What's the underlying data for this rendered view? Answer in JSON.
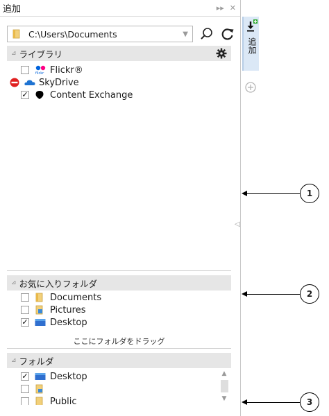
{
  "panel": {
    "title": "追加",
    "pin_glyph": "▸▸",
    "close_glyph": "✕"
  },
  "path_bar": {
    "path": "C:\\Users\\Documents",
    "dropdown_glyph": "▼",
    "icons": [
      "folder-icon",
      "search-icon",
      "refresh-icon"
    ]
  },
  "library": {
    "header": "ライブラリ",
    "collapse_glyph": "⊿",
    "items": [
      {
        "label": "Flickr®",
        "checked": false,
        "icon": "flickr-icon"
      },
      {
        "label": "SkyDrive",
        "checked": false,
        "icon": "skydrive-icon"
      },
      {
        "label": "Content Exchange",
        "checked": true,
        "icon": "content-exchange-icon"
      }
    ]
  },
  "favorites": {
    "header": "お気に入りフォルダ",
    "collapse_glyph": "⊿",
    "items": [
      {
        "label": "Documents",
        "checked": false,
        "icon": "documents-folder-icon"
      },
      {
        "label": "Pictures",
        "checked": false,
        "icon": "pictures-folder-icon"
      },
      {
        "label": "Desktop",
        "checked": true,
        "icon": "desktop-folder-icon"
      }
    ],
    "drop_hint": "ここにフォルダをドラッグ"
  },
  "folders": {
    "header": "フォルダ",
    "collapse_glyph": "⊿",
    "items": [
      {
        "label": "Desktop",
        "checked": true,
        "icon": "desktop-folder-icon"
      },
      {
        "label": "",
        "checked": false,
        "icon": "user-folder-icon"
      },
      {
        "label": "Public",
        "checked": false,
        "icon": "public-folder-icon"
      }
    ]
  },
  "side_strip": {
    "tab_label": "追加"
  },
  "callouts": [
    "1",
    "2",
    "3"
  ],
  "colors": {
    "section_header_bg": "#e6e6e6",
    "tab_bg": "#dbe8f6",
    "flickr_blue": "#0063dc",
    "flickr_pink": "#ff0084",
    "skydrive_blue": "#1e73d2",
    "no_entry_red": "#e02020"
  }
}
